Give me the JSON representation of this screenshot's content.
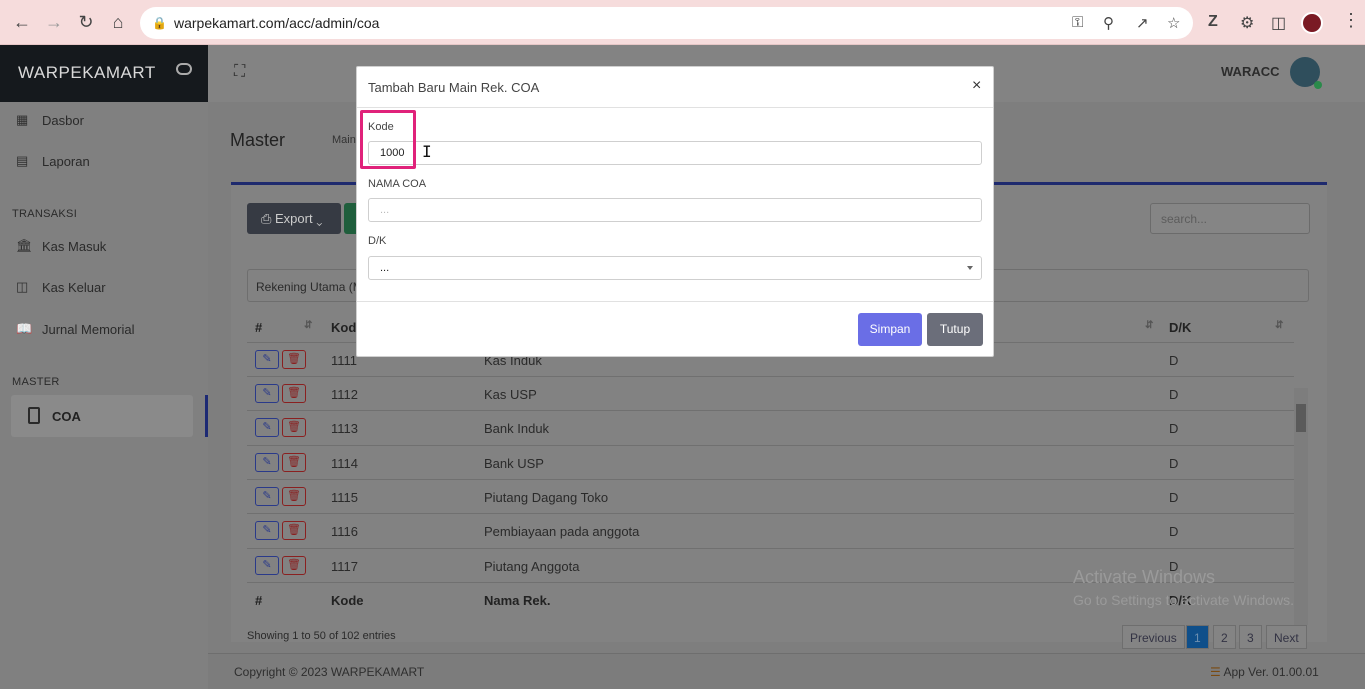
{
  "browser": {
    "url": "warpekamart.com/acc/admin/coa"
  },
  "app": {
    "brand": "WARPEKAMART",
    "user": "WARACC"
  },
  "sidebar": {
    "items": [
      {
        "label": "Dasbor"
      },
      {
        "label": "Laporan"
      }
    ],
    "section_transaksi": "TRANSAKSI",
    "transaksi": [
      {
        "label": "Kas Masuk"
      },
      {
        "label": "Kas Keluar"
      },
      {
        "label": "Jurnal Memorial"
      }
    ],
    "section_master": "MASTER",
    "master_active": "COA"
  },
  "content": {
    "title": "Master",
    "breadcrumb": "Main",
    "export_label": "Export",
    "search_placeholder": "search...",
    "filter_value": "Rekening Utama (M",
    "table": {
      "headers": {
        "num": "#",
        "kode": "Kode",
        "nama": "Nama Rek.",
        "dk": "D/K"
      },
      "rows": [
        {
          "kode": "1111",
          "nama": "Kas Induk",
          "dk": "D"
        },
        {
          "kode": "1112",
          "nama": "Kas USP",
          "dk": "D"
        },
        {
          "kode": "1113",
          "nama": "Bank Induk",
          "dk": "D"
        },
        {
          "kode": "1114",
          "nama": "Bank USP",
          "dk": "D"
        },
        {
          "kode": "1115",
          "nama": "Piutang Dagang Toko",
          "dk": "D"
        },
        {
          "kode": "1116",
          "nama": "Pembiayaan pada anggota",
          "dk": "D"
        },
        {
          "kode": "1117",
          "nama": "Piutang Anggota",
          "dk": "D"
        }
      ]
    },
    "info": "Showing 1 to 50 of 102 entries",
    "pagination": {
      "prev": "Previous",
      "pages": [
        "1",
        "2",
        "3"
      ],
      "next": "Next"
    }
  },
  "footer": {
    "copyright": "Copyright © 2023 WARPEKAMART",
    "version": "App Ver. 01.00.01"
  },
  "watermark": {
    "line1": "Activate Windows",
    "line2": "Go to Settings to activate Windows."
  },
  "modal": {
    "title": "Tambah Baru Main Rek. COA",
    "close": "×",
    "kode_label": "Kode",
    "kode_value": "1000",
    "nama_label": "NAMA COA",
    "nama_placeholder": "...",
    "dk_label": "D/K",
    "dk_value": "...",
    "save": "Simpan",
    "cancel": "Tutup"
  }
}
